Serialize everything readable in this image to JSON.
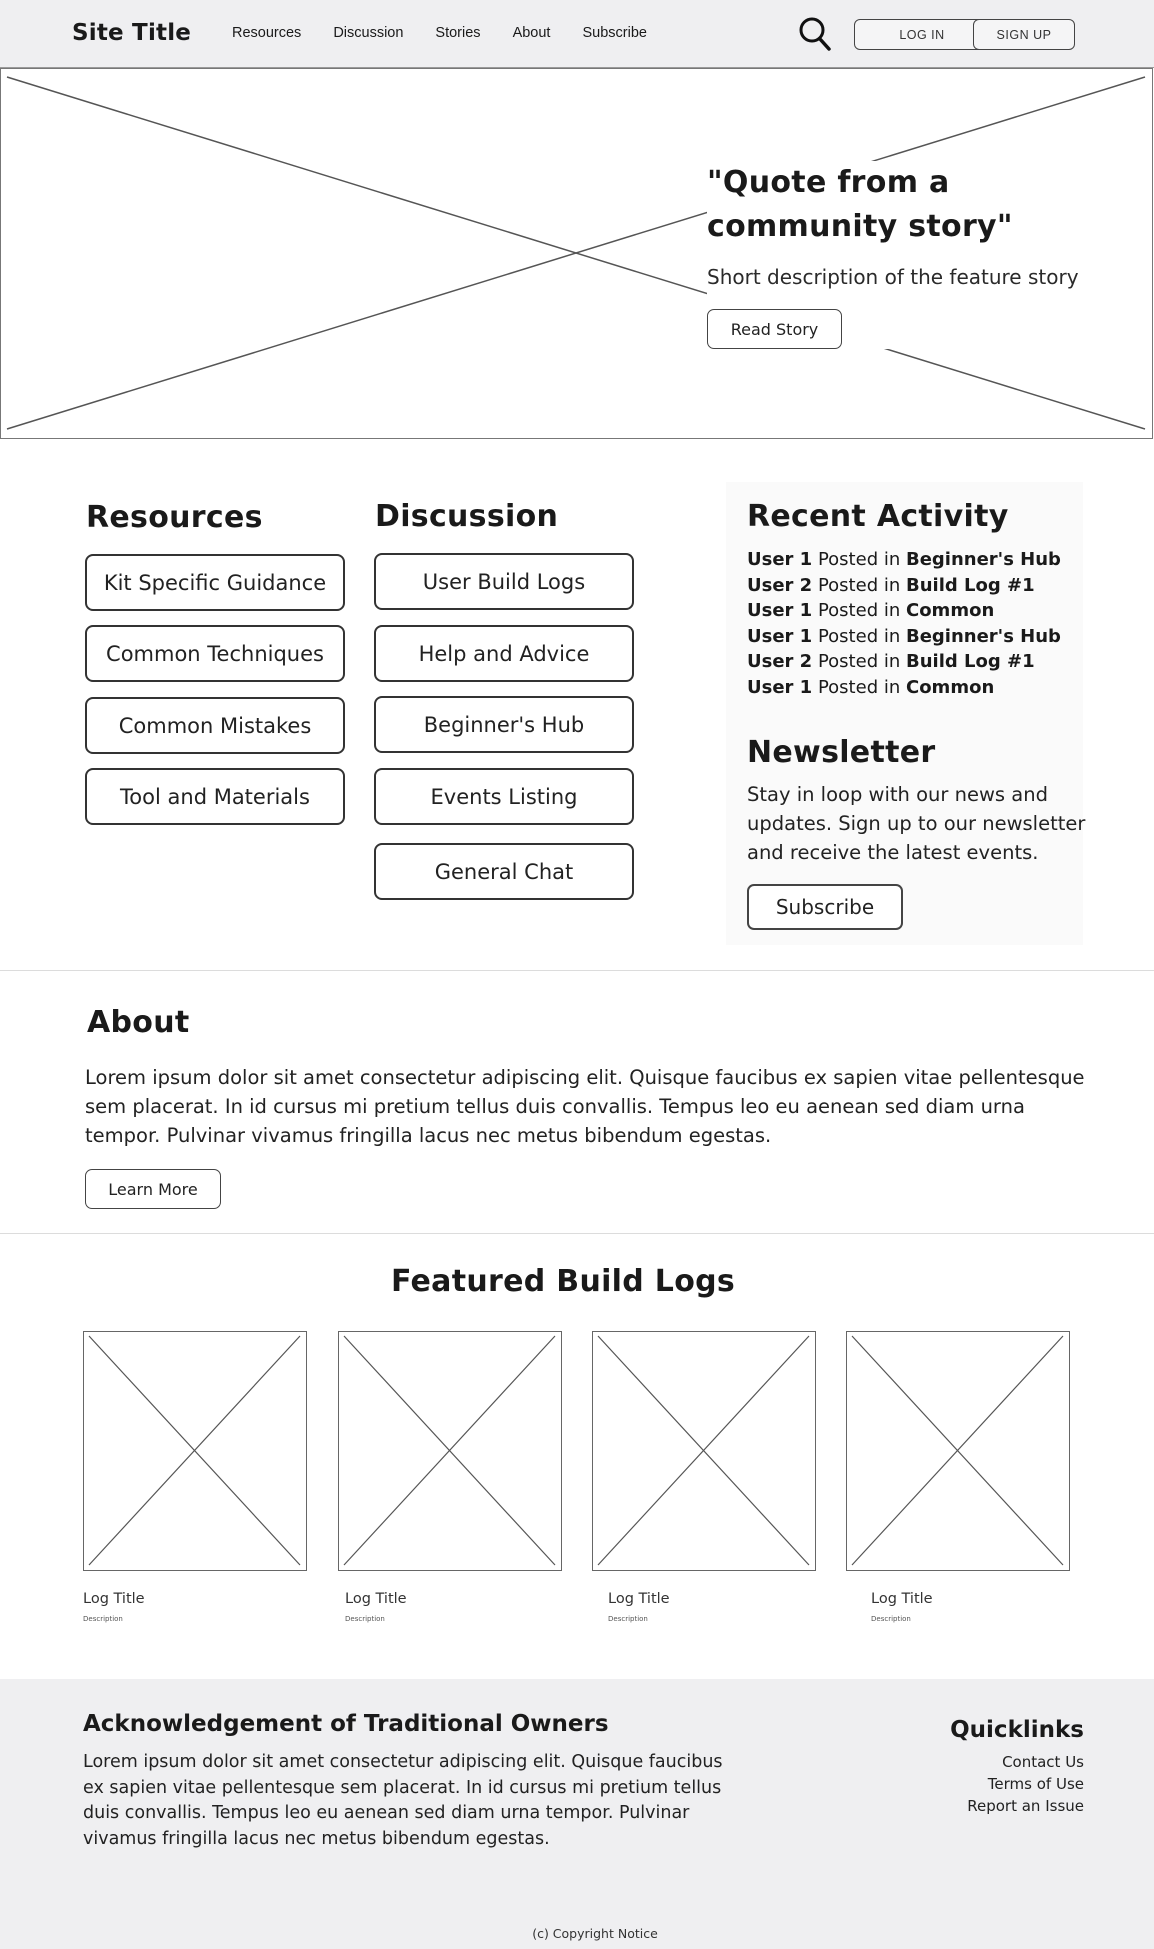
{
  "header": {
    "site_title": "Site Title",
    "nav": [
      "Resources",
      "Discussion",
      "Stories",
      "About",
      "Subscribe"
    ],
    "login_label": "LOG IN",
    "signup_label": "SIGN UP"
  },
  "hero": {
    "quote": "\"Quote from a community story\"",
    "description": "Short description of the feature story",
    "button_label": "Read Story"
  },
  "resources": {
    "title": "Resources",
    "items": [
      "Kit Specific Guidance",
      "Common Techniques",
      "Common Mistakes",
      "Tool and Materials"
    ]
  },
  "discussion": {
    "title": "Discussion",
    "items": [
      "User Build Logs",
      "Help and Advice",
      "Beginner's Hub",
      "Events Listing",
      "General Chat"
    ]
  },
  "recent_activity": {
    "title": "Recent Activity",
    "items": [
      {
        "user": "User 1",
        "action": "Posted in",
        "target": "Beginner's Hub"
      },
      {
        "user": "User 2",
        "action": "Posted in",
        "target": "Build Log #1"
      },
      {
        "user": "User 1",
        "action": "Posted in",
        "target": "Common"
      },
      {
        "user": "User 1",
        "action": "Posted in",
        "target": "Beginner's Hub"
      },
      {
        "user": "User 2",
        "action": "Posted in",
        "target": "Build Log #1"
      },
      {
        "user": "User 1",
        "action": "Posted in",
        "target": "Common"
      }
    ]
  },
  "newsletter": {
    "title": "Newsletter",
    "text": "Stay in loop with our news and updates. Sign up to our newsletter and receive the latest events.",
    "button_label": "Subscribe"
  },
  "about": {
    "title": "About",
    "text": "Lorem ipsum dolor sit amet consectetur adipiscing elit. Quisque faucibus ex sapien vitae pellentesque sem placerat. In id cursus mi pretium tellus duis convallis. Tempus leo eu aenean sed diam urna tempor. Pulvinar vivamus fringilla lacus nec metus bibendum egestas.",
    "button_label": "Learn More"
  },
  "featured": {
    "title": "Featured Build Logs",
    "logs": [
      {
        "title": "Log Title",
        "description": "Description"
      },
      {
        "title": "Log Title",
        "description": "Description"
      },
      {
        "title": "Log Title",
        "description": "Description"
      },
      {
        "title": "Log Title",
        "description": "Description"
      }
    ]
  },
  "footer": {
    "ack_title": "Acknowledgement of Traditional Owners",
    "ack_text": "Lorem ipsum dolor sit amet consectetur adipiscing elit. Quisque faucibus ex sapien vitae pellentesque sem placerat. In id cursus mi pretium tellus duis convallis. Tempus leo eu aenean sed diam urna tempor. Pulvinar vivamus fringilla lacus nec metus bibendum egestas.",
    "quicklinks_title": "Quicklinks",
    "quicklinks": [
      "Contact Us",
      "Terms of Use",
      "Report an Issue"
    ],
    "copyright": "(c) Copyright Notice"
  },
  "icons": {
    "search": "search-icon",
    "image_placeholder": "image-placeholder-icon"
  }
}
